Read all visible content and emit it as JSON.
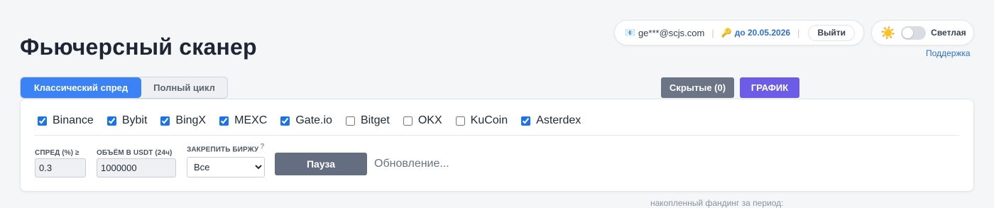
{
  "page": {
    "title": "Фьючерсный сканер"
  },
  "user": {
    "mail_icon": "📧",
    "email": "ge***@scjs.com",
    "separator": "|",
    "key_icon": "🔑",
    "expiry": "до 20.05.2026",
    "logout_label": "Выйти"
  },
  "theme": {
    "sun_icon": "☀️",
    "label": "Светлая",
    "dark_mode": false
  },
  "support_link": "Поддержка",
  "tabs": [
    {
      "label": "Классический спред",
      "active": true
    },
    {
      "label": "Полный цикл",
      "active": false
    }
  ],
  "actions": {
    "hidden_label": "Скрытые (0)",
    "chart_label": "ГРАФИК"
  },
  "exchanges": [
    {
      "name": "Binance",
      "checked": true
    },
    {
      "name": "Bybit",
      "checked": true
    },
    {
      "name": "BingX",
      "checked": true
    },
    {
      "name": "MEXC",
      "checked": true
    },
    {
      "name": "Gate.io",
      "checked": true
    },
    {
      "name": "Bitget",
      "checked": false
    },
    {
      "name": "OKX",
      "checked": false
    },
    {
      "name": "KuCoin",
      "checked": false
    },
    {
      "name": "Asterdex",
      "checked": true
    }
  ],
  "filters": {
    "spread_label": "СПРЕД (%) ≥",
    "spread_value": "0.3",
    "volume_label": "ОБЪЁМ В USDT (24ч)",
    "volume_value": "1000000",
    "pin_label": "ЗАКРЕПИТЬ БИРЖУ",
    "pin_hint": "?",
    "pin_selected": "Все"
  },
  "pause_label": "Пауза",
  "status_text": "Обновление...",
  "funding_note": "накопленный фандинг за период:",
  "colors": {
    "accent_blue": "#3b82f6",
    "chart_purple": "#6d5ce7",
    "hidden_gray": "#6b7585",
    "pause_gray": "#646e80",
    "link_blue": "#2f6fd6"
  }
}
